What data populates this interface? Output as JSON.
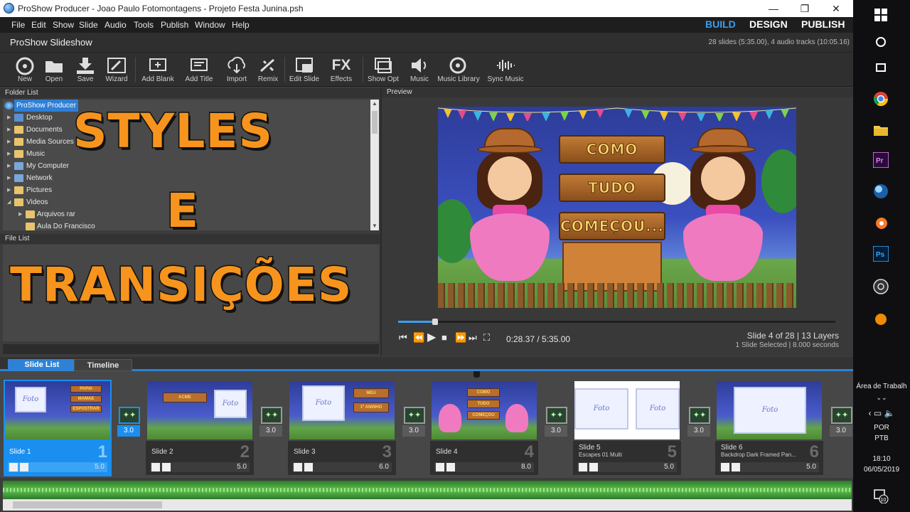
{
  "window": {
    "title": "ProShow Producer - Joao Paulo Fotomontagens - Projeto Festa Junina.psh",
    "minimize": "—",
    "maximize": "❐",
    "close": "✕"
  },
  "menu": {
    "items": [
      "File",
      "Edit",
      "Show",
      "Slide",
      "Audio",
      "Tools",
      "Publish",
      "Window",
      "Help"
    ],
    "modes": [
      "BUILD",
      "DESIGN",
      "PUBLISH"
    ],
    "active_mode": "BUILD"
  },
  "show": {
    "name": "ProShow Slideshow",
    "info": "28 slides (5:35.00), 4 audio tracks (10:05.16)"
  },
  "toolbar": [
    {
      "label": "New",
      "icon": "new-show-icon"
    },
    {
      "label": "Open",
      "icon": "folder-open-icon"
    },
    {
      "label": "Save",
      "icon": "save-icon"
    },
    {
      "label": "Wizard",
      "icon": "wizard-icon"
    },
    {
      "label": "Add Blank",
      "icon": "add-blank-icon"
    },
    {
      "label": "Add Title",
      "icon": "add-title-icon"
    },
    {
      "label": "Import",
      "icon": "import-icon"
    },
    {
      "label": "Remix",
      "icon": "remix-icon"
    },
    {
      "label": "Edit Slide",
      "icon": "edit-slide-icon"
    },
    {
      "label": "Effects",
      "icon": "fx-icon"
    },
    {
      "label": "Show Opt",
      "icon": "show-options-icon"
    },
    {
      "label": "Music",
      "icon": "speaker-icon"
    },
    {
      "label": "Music Library",
      "icon": "music-library-icon"
    },
    {
      "label": "Sync Music",
      "icon": "sync-music-icon"
    }
  ],
  "toolbar_glyphs": {
    "effects": "FX"
  },
  "folder_list": {
    "header": "Folder List",
    "items": [
      {
        "label": "ProShow Producer",
        "level": 0,
        "selected": true
      },
      {
        "label": "Desktop",
        "level": 1
      },
      {
        "label": "Documents",
        "level": 1
      },
      {
        "label": "Media Sources",
        "level": 1
      },
      {
        "label": "Music",
        "level": 1
      },
      {
        "label": "My Computer",
        "level": 1
      },
      {
        "label": "Network",
        "level": 1
      },
      {
        "label": "Pictures",
        "level": 1
      },
      {
        "label": "Videos",
        "level": 1,
        "expanded": true
      },
      {
        "label": "Arquivos rar",
        "level": 2
      },
      {
        "label": "Aula Do Francisco",
        "level": 2
      }
    ]
  },
  "file_list": {
    "header": "File List"
  },
  "overlay": {
    "line1": "STYLES",
    "line2": "E",
    "line3": "TRANSIÇÕES"
  },
  "preview": {
    "header": "Preview",
    "signs": [
      "COMO",
      "TUDO",
      "COMEÇOU..."
    ],
    "timecode": "0:28.37 / 5:35.00",
    "slide_info": "Slide 4 of 28  |  13 Layers",
    "selection_info": "1 Slide Selected  |  8.000 seconds",
    "progress": 0.085
  },
  "tabs": [
    "Slide List",
    "Timeline"
  ],
  "slides": [
    {
      "name": "Slide 1",
      "subtitle": "",
      "number": "1",
      "duration": "5.0",
      "selected": true
    },
    {
      "name": "Slide 2",
      "subtitle": "",
      "number": "2",
      "duration": "5.0"
    },
    {
      "name": "Slide 3",
      "subtitle": "",
      "number": "3",
      "duration": "6.0"
    },
    {
      "name": "Slide 4",
      "subtitle": "",
      "number": "4",
      "duration": "8.0"
    },
    {
      "name": "Slide 5",
      "subtitle": "Escapes 01 Multi",
      "number": "5",
      "duration": "5.0"
    },
    {
      "name": "Slide 6",
      "subtitle": "Backdrop Dark Framed Pan...",
      "number": "6",
      "duration": "5.0"
    }
  ],
  "slide_thumb_text": {
    "foto": "Foto",
    "slide1": [
      "PAPAI",
      "MAMAE",
      "ESPOSTRAR"
    ],
    "slide2": [
      "ACME"
    ],
    "slide3": [
      "MEU",
      "1º ANINHO"
    ],
    "slide4": [
      "COMO",
      "TUDO",
      "COMEÇOU"
    ]
  },
  "transitions": [
    "3.0",
    "3.0",
    "3.0",
    "3.0",
    "3.0",
    "3.0"
  ],
  "taskbar": {
    "desktop_label": "Área de Trabalh",
    "lang": "POR",
    "layout": "PTB",
    "time": "18:10",
    "date": "06/05/2019",
    "notifications": "10"
  }
}
